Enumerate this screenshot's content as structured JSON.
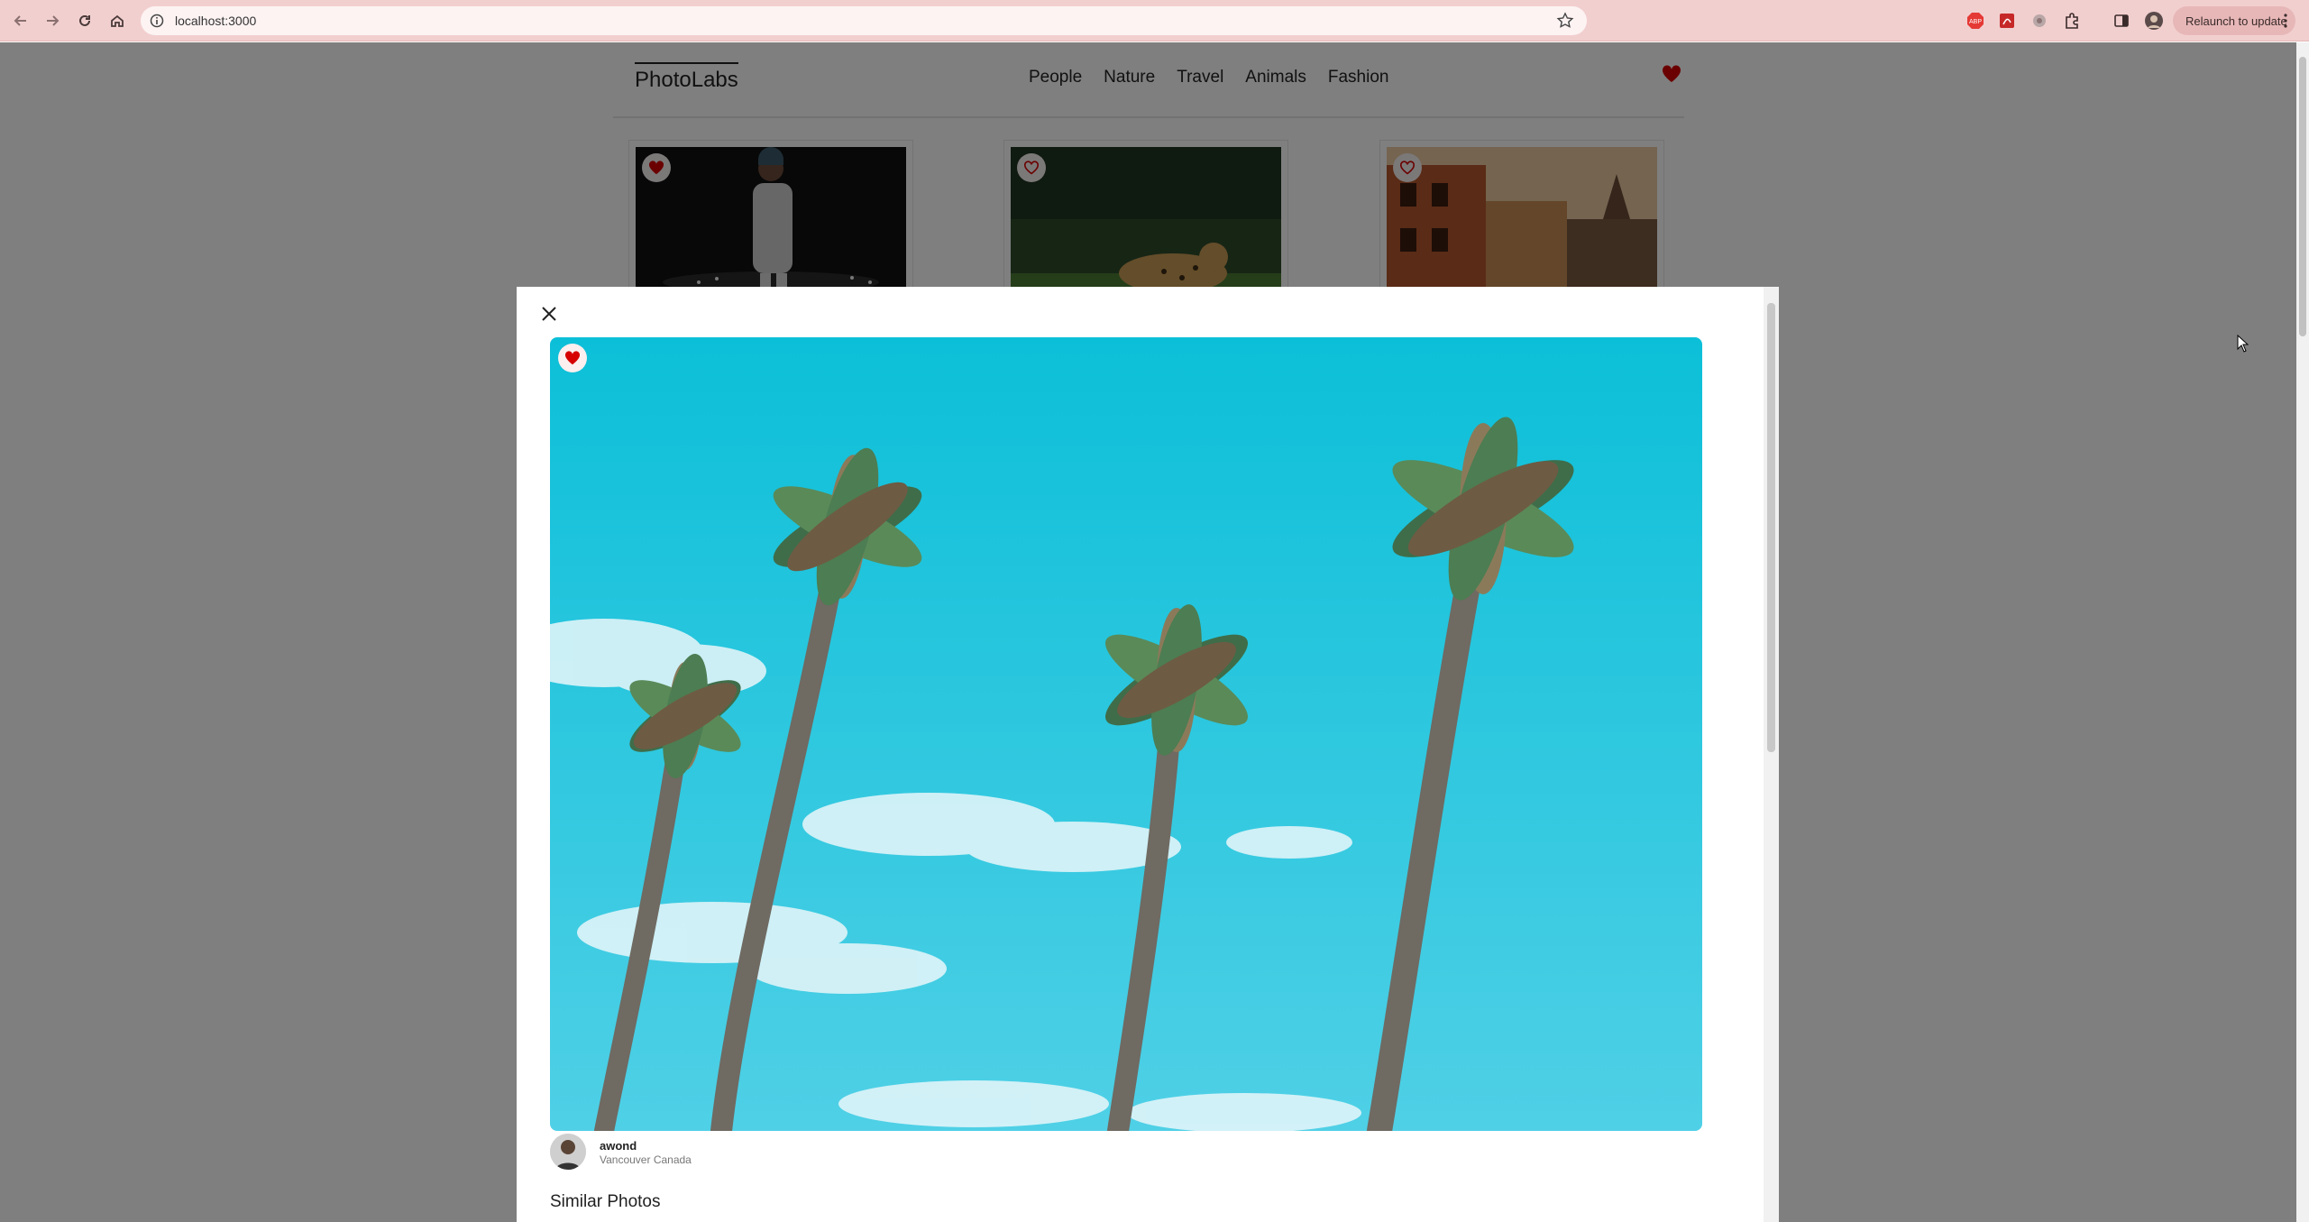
{
  "browser": {
    "url": "localhost:3000",
    "relaunch_label": "Relaunch to update",
    "extensions": [
      "adblock-icon",
      "pdf-icon",
      "extension-icon",
      "puzzle-icon"
    ]
  },
  "nav": {
    "logo": "PhotoLabs",
    "topics": [
      "People",
      "Nature",
      "Travel",
      "Animals",
      "Fashion"
    ]
  },
  "modal": {
    "user": {
      "name": "awond",
      "location": "Vancouver Canada"
    },
    "similar_heading": "Similar Photos"
  },
  "colors": {
    "heart": "#d60000",
    "sky": "#16c0d8",
    "chrome": "#f2cfcf"
  }
}
